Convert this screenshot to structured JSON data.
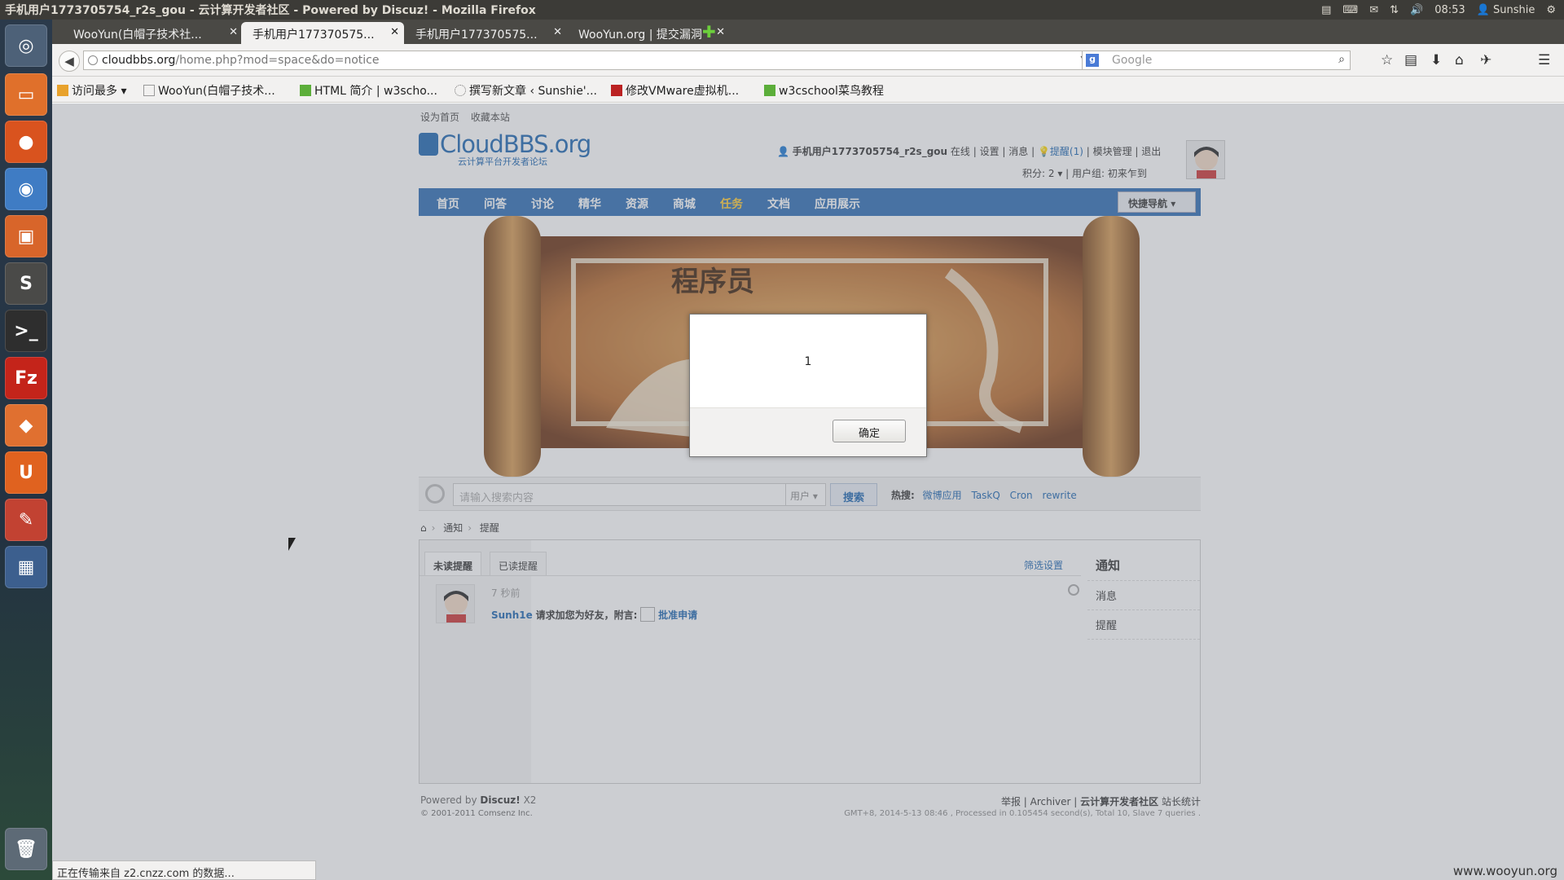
{
  "system": {
    "window_title": "手机用户1773705754_r2s_gou - 云计算开发者社区 - Powered by Discuz! - Mozilla Firefox",
    "time": "08:53",
    "user": "Sunshie"
  },
  "tabs": [
    {
      "label": "WooYun(白帽子技术社..."
    },
    {
      "label": "手机用户177370575..."
    },
    {
      "label": "手机用户177370575..."
    },
    {
      "label": "WooYun.org | 提交漏洞"
    }
  ],
  "address": {
    "host": "cloudbbs.org",
    "path": "/home.php?mod=space&do=notice"
  },
  "search": {
    "placeholder": "Google"
  },
  "bookmarks": [
    {
      "label": "访问最多"
    },
    {
      "label": "WooYun(白帽子技术..."
    },
    {
      "label": "HTML 简介 | w3scho..."
    },
    {
      "label": "撰写新文章 ‹ Sunshie'..."
    },
    {
      "label": "修改VMware虚拟机..."
    },
    {
      "label": "w3cschool菜鸟教程"
    }
  ],
  "site": {
    "toplinks": [
      "设为首页",
      "收藏本站"
    ],
    "logo_main": "CloudBBS.org",
    "logo_sub": "云计算平台开发者论坛",
    "user": {
      "name": "手机用户1773705754_r2s_gou",
      "status": "在线",
      "settings": "设置",
      "messages": "消息",
      "reminders": "提醒(1)",
      "module_manage": "模块管理",
      "logout": "退出",
      "points": "积分: 2",
      "group": "用户组: 初来乍到"
    },
    "nav": [
      "首页",
      "问答",
      "讨论",
      "精华",
      "资源",
      "商城",
      "任务",
      "文档",
      "应用展示"
    ],
    "quick_nav": "快捷导航",
    "banner_text": "程序员",
    "search_placeholder": "请输入搜索内容",
    "search_type": "用户",
    "search_button": "搜索",
    "hot_label": "热搜:",
    "hot_words": [
      "微博应用",
      "TaskQ",
      "Cron",
      "rewrite"
    ],
    "breadcrumb": [
      "通知",
      "提醒"
    ],
    "content_tabs": [
      "未读提醒",
      "已读提醒"
    ],
    "filter": "筛选设置",
    "notice": {
      "time": "7 秒前",
      "user": "Sunh1e",
      "text": "请求加您为好友，附言:",
      "action": "批准申请"
    },
    "sidebar_title": "通知",
    "sidebar_items": [
      "消息",
      "提醒"
    ],
    "footer_powered": "Powered by",
    "footer_brand": "Discuz!",
    "footer_version": "X2",
    "footer_copy": "© 2001-2011 Comsenz Inc.",
    "footer_links": [
      "举报",
      "Archiver",
      "云计算开发者社区",
      "站长统计"
    ],
    "footer_stats": "GMT+8, 2014-5-13 08:46 , Processed in 0.105454 second(s), Total 10, Slave 7 queries ."
  },
  "dialog": {
    "message": "1",
    "ok": "确定"
  },
  "status_text": "正在传输来自 z2.cnzz.com 的数据...",
  "watermark": "www.wooyun.org"
}
